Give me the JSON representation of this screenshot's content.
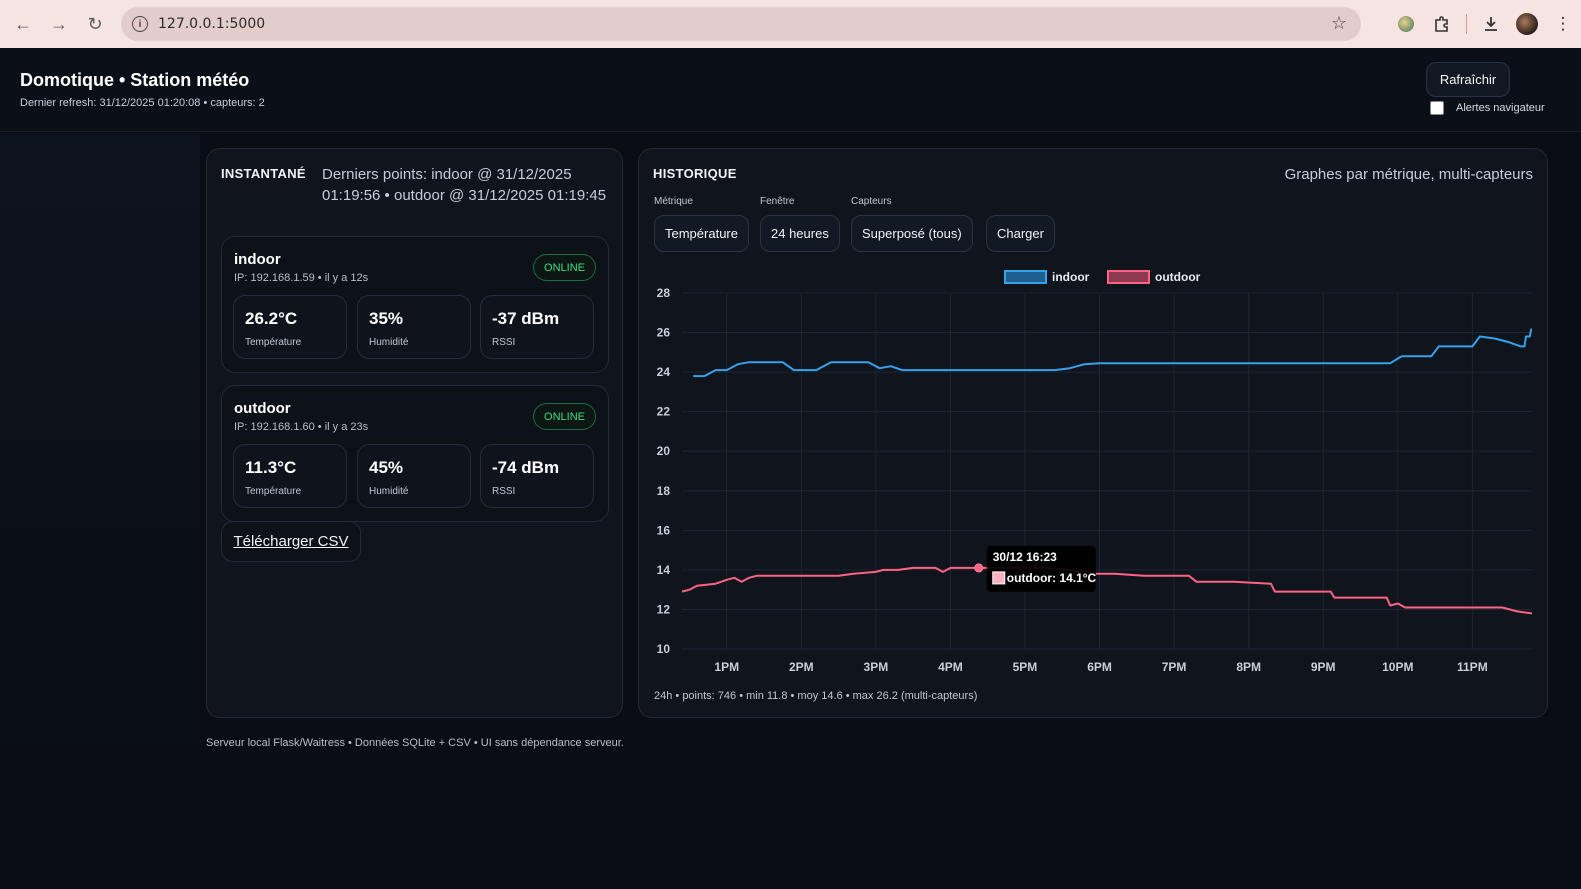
{
  "browser": {
    "url": "127.0.0.1:5000"
  },
  "header": {
    "title": "Domotique • Station météo",
    "subtitle": "Dernier refresh: 31/12/2025 01:20:08 • capteurs: 2",
    "refresh_label": "Rafraîchir",
    "alerts_label": "Alertes navigateur",
    "alerts_checked": false
  },
  "snapshot": {
    "title": "INSTANTANÉ",
    "last_points": "Derniers points: indoor @ 31/12/2025 01:19:56 • outdoor @ 31/12/2025 01:19:45",
    "sensors": [
      {
        "name": "indoor",
        "meta": "IP: 192.168.1.59 • il y a 12s",
        "status": "ONLINE",
        "metrics": [
          {
            "value": "26.2°C",
            "label": "Température"
          },
          {
            "value": "35%",
            "label": "Humidité"
          },
          {
            "value": "-37 dBm",
            "label": "RSSI"
          }
        ]
      },
      {
        "name": "outdoor",
        "meta": "IP: 192.168.1.60 • il y a 23s",
        "status": "ONLINE",
        "metrics": [
          {
            "value": "11.3°C",
            "label": "Température"
          },
          {
            "value": "45%",
            "label": "Humidité"
          },
          {
            "value": "-74 dBm",
            "label": "RSSI"
          }
        ]
      }
    ],
    "csv_label": "Télécharger CSV"
  },
  "history": {
    "title": "HISTORIQUE",
    "description": "Graphes par métrique, multi-capteurs",
    "controls": [
      {
        "label": "Métrique",
        "value": "Température"
      },
      {
        "label": "Fenêtre",
        "value": "24 heures"
      },
      {
        "label": "Capteurs",
        "value": "Superposé (tous)"
      }
    ],
    "load_label": "Charger",
    "footer": "24h • points: 746 • min 11.8 • moy 14.6 • max 26.2 (multi-capteurs)"
  },
  "chart_data": {
    "type": "line",
    "xlabel": "",
    "ylabel": "",
    "ylim": [
      10,
      28
    ],
    "y_ticks": [
      "10",
      "12",
      "14",
      "16",
      "18",
      "20",
      "22",
      "24",
      "26",
      "28"
    ],
    "x_ticks": [
      "1PM",
      "2PM",
      "3PM",
      "4PM",
      "5PM",
      "6PM",
      "7PM",
      "8PM",
      "9PM",
      "10PM",
      "11PM"
    ],
    "x_range_hours": [
      12.4,
      23.8
    ],
    "grid": true,
    "legend_position": "top-center",
    "series": [
      {
        "name": "indoor",
        "color": "#36a2eb",
        "fill": "#1f5f8f",
        "points": [
          [
            12.55,
            23.8
          ],
          [
            12.7,
            23.8
          ],
          [
            12.85,
            24.1
          ],
          [
            13.0,
            24.1
          ],
          [
            13.15,
            24.4
          ],
          [
            13.3,
            24.5
          ],
          [
            13.55,
            24.5
          ],
          [
            13.75,
            24.5
          ],
          [
            13.9,
            24.1
          ],
          [
            14.2,
            24.1
          ],
          [
            14.4,
            24.5
          ],
          [
            14.6,
            24.5
          ],
          [
            14.8,
            24.5
          ],
          [
            14.9,
            24.5
          ],
          [
            15.05,
            24.2
          ],
          [
            15.2,
            24.3
          ],
          [
            15.35,
            24.1
          ],
          [
            15.6,
            24.1
          ],
          [
            16.0,
            24.1
          ],
          [
            16.5,
            24.1
          ],
          [
            17.0,
            24.1
          ],
          [
            17.4,
            24.1
          ],
          [
            17.6,
            24.2
          ],
          [
            17.8,
            24.4
          ],
          [
            18.0,
            24.45
          ],
          [
            18.5,
            24.45
          ],
          [
            19.0,
            24.45
          ],
          [
            19.5,
            24.45
          ],
          [
            20.0,
            24.45
          ],
          [
            20.5,
            24.45
          ],
          [
            21.0,
            24.45
          ],
          [
            21.5,
            24.45
          ],
          [
            21.9,
            24.45
          ],
          [
            22.05,
            24.8
          ],
          [
            22.3,
            24.8
          ],
          [
            22.45,
            24.8
          ],
          [
            22.55,
            25.3
          ],
          [
            22.75,
            25.3
          ],
          [
            22.9,
            25.3
          ],
          [
            23.0,
            25.3
          ],
          [
            23.1,
            25.8
          ],
          [
            23.3,
            25.7
          ],
          [
            23.5,
            25.5
          ],
          [
            23.65,
            25.3
          ],
          [
            23.7,
            25.3
          ],
          [
            23.72,
            25.8
          ],
          [
            23.77,
            25.8
          ],
          [
            23.79,
            26.2
          ]
        ]
      },
      {
        "name": "outdoor",
        "color": "#ff6384",
        "fill": "#8f3a4c",
        "points": [
          [
            12.4,
            12.9
          ],
          [
            12.5,
            13.0
          ],
          [
            12.6,
            13.2
          ],
          [
            12.85,
            13.3
          ],
          [
            13.0,
            13.5
          ],
          [
            13.1,
            13.6
          ],
          [
            13.2,
            13.4
          ],
          [
            13.3,
            13.6
          ],
          [
            13.4,
            13.7
          ],
          [
            13.8,
            13.7
          ],
          [
            14.2,
            13.7
          ],
          [
            14.5,
            13.7
          ],
          [
            14.7,
            13.8
          ],
          [
            15.0,
            13.9
          ],
          [
            15.1,
            14.0
          ],
          [
            15.3,
            14.0
          ],
          [
            15.5,
            14.1
          ],
          [
            15.8,
            14.1
          ],
          [
            15.9,
            13.9
          ],
          [
            16.0,
            14.1
          ],
          [
            16.38,
            14.1
          ],
          [
            16.6,
            14.1
          ],
          [
            17.0,
            14.1
          ],
          [
            17.3,
            14.1
          ],
          [
            17.6,
            14.0
          ],
          [
            17.8,
            13.9
          ],
          [
            17.95,
            13.8
          ],
          [
            18.2,
            13.8
          ],
          [
            18.6,
            13.7
          ],
          [
            19.0,
            13.7
          ],
          [
            19.2,
            13.7
          ],
          [
            19.3,
            13.4
          ],
          [
            19.8,
            13.4
          ],
          [
            20.3,
            13.3
          ],
          [
            20.35,
            12.9
          ],
          [
            20.8,
            12.9
          ],
          [
            21.1,
            12.9
          ],
          [
            21.15,
            12.6
          ],
          [
            21.6,
            12.6
          ],
          [
            21.85,
            12.6
          ],
          [
            21.9,
            12.2
          ],
          [
            22.0,
            12.3
          ],
          [
            22.1,
            12.1
          ],
          [
            22.5,
            12.1
          ],
          [
            23.0,
            12.1
          ],
          [
            23.4,
            12.1
          ],
          [
            23.5,
            12.0
          ],
          [
            23.6,
            11.9
          ],
          [
            23.8,
            11.8
          ]
        ]
      }
    ],
    "tooltip": {
      "title": "30/12 16:23",
      "text": "outdoor: 14.1°C",
      "x": 16.38,
      "y": 14.1
    }
  },
  "footer": {
    "text": "Serveur local Flask/Waitress • Données SQLite + CSV • UI sans dépendance serveur."
  }
}
